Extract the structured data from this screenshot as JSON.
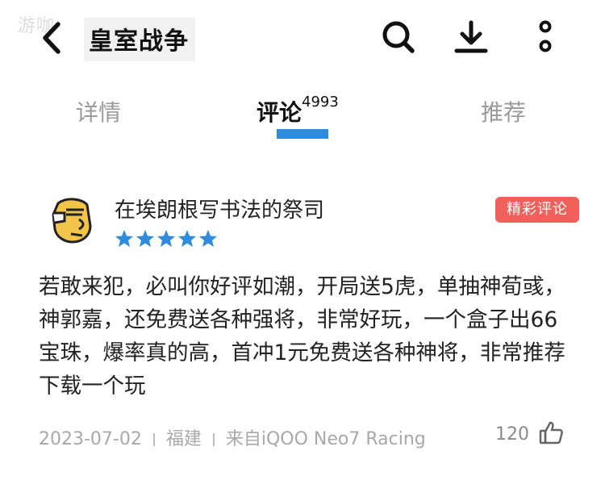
{
  "header": {
    "title": "皇室战争",
    "watermark": "游咖",
    "icons": [
      "back-icon",
      "search-icon",
      "download-icon",
      "more-icon"
    ]
  },
  "tabs": [
    {
      "label": "详情",
      "active": false
    },
    {
      "label": "评论",
      "count": "4993",
      "active": true
    },
    {
      "label": "推荐",
      "active": false
    }
  ],
  "accent_color": "#2f8bdc",
  "comment": {
    "username": "在埃朗根写书法的祭司",
    "rating": 5,
    "badge": "精彩评论",
    "badge_color": "#f1605a",
    "text": "若敢来犯，必叫你好评如潮，开局送5虎，单抽神荀彧，神郭嘉，还免费送各种强将，非常好玩，一个盒子出66宝珠，爆率真的高，首冲1元免费送各种神将，非常推荐下载一个玩",
    "date": "2023-07-02",
    "location": "福建",
    "device": "来自iQOO Neo7 Racing",
    "likes": "120"
  }
}
